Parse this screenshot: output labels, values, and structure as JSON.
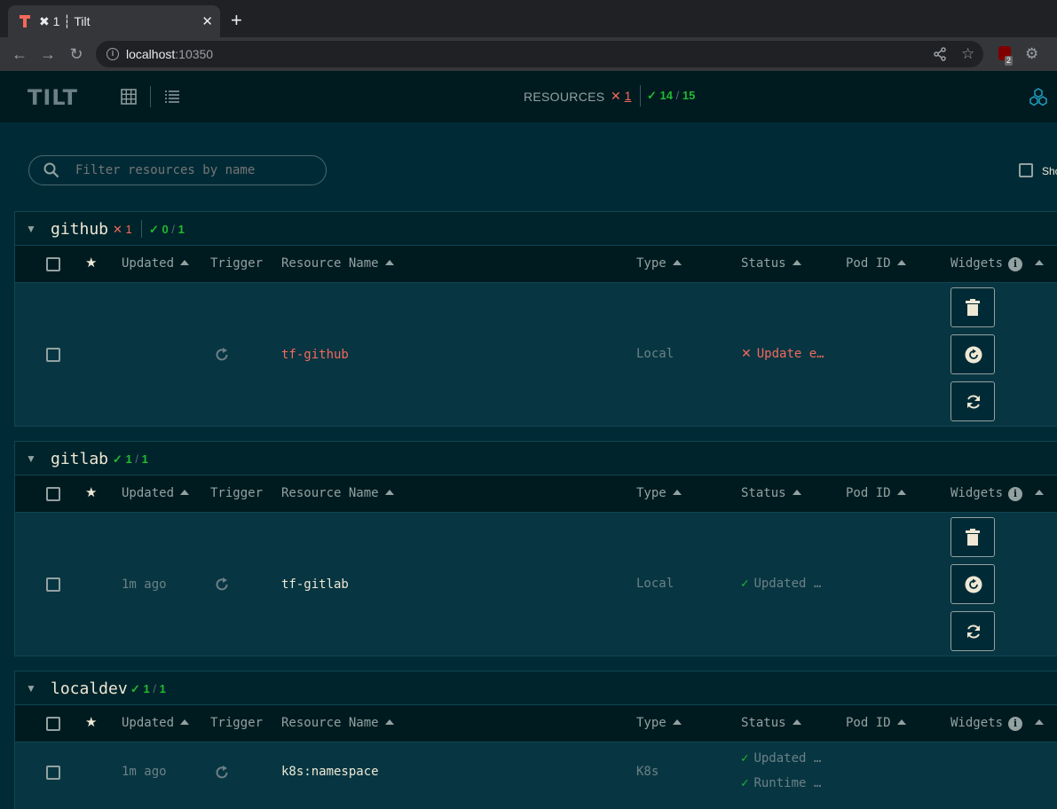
{
  "browser": {
    "tab_title": "✖ 1 ┆ Tilt",
    "url_host": "localhost",
    "url_port": ":10350",
    "ext_badge": "2"
  },
  "header": {
    "logo": "TILT",
    "resources_label": "RESOURCES",
    "error_mark": "✕",
    "error_count": "1",
    "ok_mark": "✓",
    "ok_count": "14",
    "ok_sep": "/",
    "ok_total": "15"
  },
  "filter": {
    "placeholder": "Filter resources by name",
    "show_label": "Show"
  },
  "columns": {
    "updated": "Updated",
    "trigger": "Trigger",
    "resource_name": "Resource Name",
    "type": "Type",
    "status": "Status",
    "pod_id": "Pod ID",
    "widgets": "Widgets"
  },
  "groups": [
    {
      "name": "github",
      "error_mark": "✕",
      "errors": "1",
      "ok_mark": "✓",
      "ok": "0",
      "sep": "/",
      "total": "1",
      "rows": [
        {
          "updated": "",
          "name": "tf-github",
          "type": "Local",
          "status": "Update e…",
          "status_kind": "error"
        }
      ]
    },
    {
      "name": "gitlab",
      "ok_mark": "✓",
      "ok": "1",
      "sep": "/",
      "total": "1",
      "rows": [
        {
          "updated": "1m ago",
          "name": "tf-gitlab",
          "type": "Local",
          "status": "Updated …",
          "status_kind": "ok"
        }
      ]
    },
    {
      "name": "localdev",
      "ok_mark": "✓",
      "ok": "1",
      "sep": "/",
      "total": "1",
      "rows": [
        {
          "updated": "1m ago",
          "name": "k8s:namespace",
          "type": "K8s",
          "status": "Updated …",
          "status2": "Runtime …",
          "status_kind": "ok"
        }
      ]
    }
  ],
  "colors": {
    "background": "#002b36",
    "error": "#f6685c",
    "ok": "#20ba31",
    "text": "#eee8d5"
  }
}
